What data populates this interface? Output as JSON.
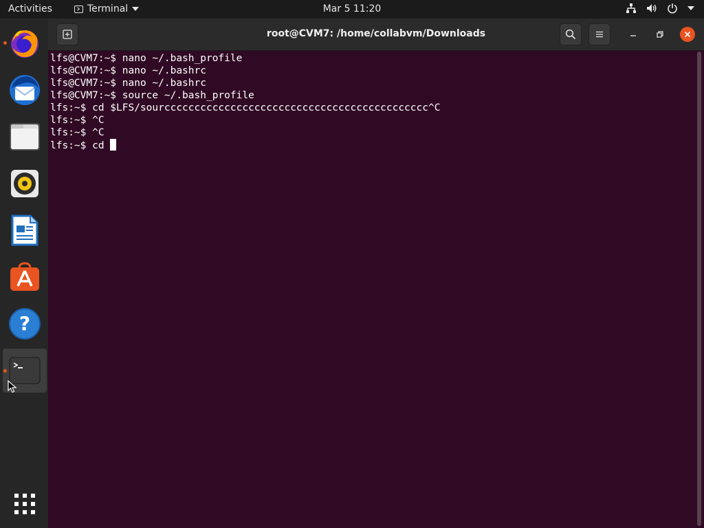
{
  "topbar": {
    "activities": "Activities",
    "app_name": "Terminal",
    "clock": "Mar 5  11:20",
    "tray_icons": [
      "network-icon",
      "volume-icon",
      "power-icon",
      "system-menu-arrow"
    ]
  },
  "dock": {
    "items": [
      {
        "name": "firefox",
        "running": true
      },
      {
        "name": "thunderbird",
        "running": false
      },
      {
        "name": "files",
        "running": false
      },
      {
        "name": "rhythmbox",
        "running": false
      },
      {
        "name": "libreoffice-writer",
        "running": false
      },
      {
        "name": "ubuntu-software",
        "running": false
      },
      {
        "name": "help",
        "running": false
      },
      {
        "name": "terminal",
        "running": true,
        "active": true
      }
    ],
    "show_apps": "show-applications-grid"
  },
  "window": {
    "title": "root@CVM7: /home/collabvm/Downloads",
    "new_tab_icon": "new-tab-icon",
    "search_icon": "search-icon",
    "menu_icon": "hamburger-menu-icon"
  },
  "terminal": {
    "lines": [
      "lfs@CVM7:~$ nano ~/.bash_profile",
      "lfs@CVM7:~$ nano ~/.bashrc",
      "lfs@CVM7:~$ nano ~/.bashrc",
      "lfs@CVM7:~$ source ~/.bash_profile",
      "lfs:~$ cd $LFS/sourcccccccccccccccccccccccccccccccccccccccccccc^C",
      "lfs:~$ ^C",
      "lfs:~$ ^C"
    ],
    "prompt_line": "lfs:~$ cd "
  },
  "colors": {
    "terminal_bg": "#300a24",
    "accent": "#e95420",
    "close_button": "#e95420"
  }
}
